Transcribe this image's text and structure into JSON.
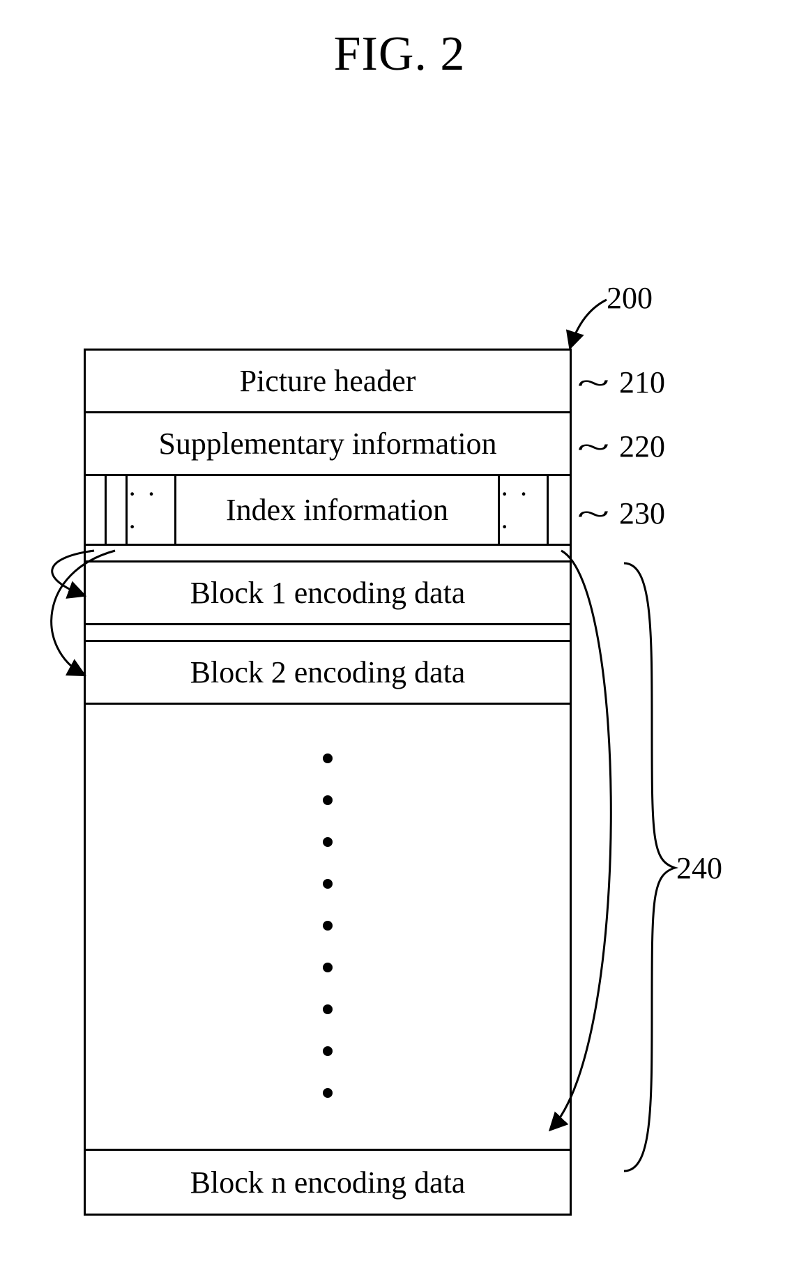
{
  "figure_title": "FIG. 2",
  "refs": {
    "bitstream": "200",
    "picture_header": "210",
    "supplementary_info": "220",
    "index_info": "230",
    "blocks": "240"
  },
  "rows": {
    "picture_header": "Picture header",
    "supplementary_info": "Supplementary information",
    "index_info": "Index information",
    "block1": "Block 1 encoding data",
    "block2": "Block 2 encoding data",
    "blockn": "Block n encoding data"
  },
  "glyphs": {
    "hellipsis": "· · ·"
  }
}
